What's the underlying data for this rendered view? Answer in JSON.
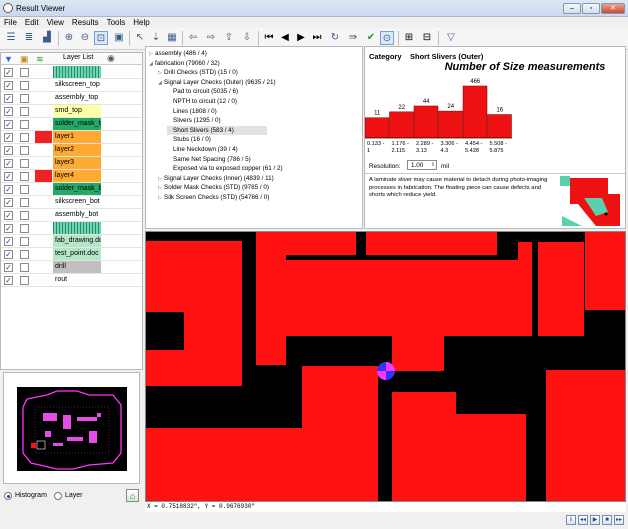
{
  "window": {
    "title": "Result Viewer",
    "buttons": [
      "–",
      "▫",
      "✕"
    ]
  },
  "menu": [
    "File",
    "Edit",
    "View",
    "Results",
    "Tools",
    "Help"
  ],
  "toolbar": {
    "icons": [
      "list-icon",
      "list-detail-icon",
      "chart-icon",
      "zoom-in-icon",
      "zoom-out-icon",
      "zoom-window-icon",
      "fit-icon",
      "pointer-icon",
      "down-arrow-icon",
      "grid-icon",
      "arrow-left-icon",
      "arrow-right-icon",
      "arrow-up-icon",
      "arrow-down-icon",
      "first-icon",
      "prev-icon",
      "next-icon",
      "last-icon",
      "refresh-icon",
      "forward-icon",
      "check-icon",
      "measure-icon",
      "export-icon",
      "report-icon",
      "filter-icon"
    ]
  },
  "layers": {
    "header": {
      "title": "Layer List"
    },
    "rows": [
      {
        "name": "",
        "visible": true,
        "bg": "#6fd6b4",
        "fill_pattern": true
      },
      {
        "name": "silkscreen_top",
        "visible": true,
        "bg": "#ffffff"
      },
      {
        "name": "assembly_top",
        "visible": true,
        "bg": "#ffffff"
      },
      {
        "name": "smd_top",
        "visible": true,
        "bg": "#ffffaa"
      },
      {
        "name": "solder_mask_top",
        "visible": true,
        "bg": "#22aa66"
      },
      {
        "name": "layer1",
        "visible": true,
        "bg": "#ffaa33",
        "marker": "#ee2222"
      },
      {
        "name": "layer2",
        "visible": true,
        "bg": "#ffaa33"
      },
      {
        "name": "layer3",
        "visible": true,
        "bg": "#ffaa33"
      },
      {
        "name": "layer4",
        "visible": true,
        "bg": "#ffaa33",
        "marker": "#ee2222"
      },
      {
        "name": "solder_mask_bot",
        "visible": true,
        "bg": "#22aa66"
      },
      {
        "name": "silkscreen_bot",
        "visible": true,
        "bg": "#ffffff"
      },
      {
        "name": "assembly_bot",
        "visible": true,
        "bg": "#ffffff"
      },
      {
        "name": "",
        "visible": true,
        "bg": "#6fd6b4",
        "fill_pattern": true
      },
      {
        "name": "fab_drawing.doc",
        "visible": true,
        "bg": "#b5e6c8"
      },
      {
        "name": "test_point.doc",
        "visible": true,
        "bg": "#b5e6c8"
      },
      {
        "name": "drill",
        "visible": true,
        "bg": "#c0c0c0"
      },
      {
        "name": "rout",
        "visible": true,
        "bg": "#ffffff"
      }
    ]
  },
  "bottom_left": {
    "histogram": "Histogram",
    "layer": "Layer",
    "histogram_selected": true
  },
  "tree": [
    {
      "text": "assembly (486 / 4)",
      "level": 0,
      "arrow": "▷"
    },
    {
      "text": "fabrication (79060 / 32)",
      "level": 0,
      "arrow": "◢"
    },
    {
      "text": "Drill Checks (STD) (15 / 0)",
      "level": 1,
      "arrow": "▷"
    },
    {
      "text": "Signal Layer Checks (Outer) (9635 / 21)",
      "level": 1,
      "arrow": "◢"
    },
    {
      "text": "Pad to circuit (5035 / 6)",
      "level": 2
    },
    {
      "text": "NPTH to circuit (12 / 0)",
      "level": 2
    },
    {
      "text": "Lines (1808 / 0)",
      "level": 2
    },
    {
      "text": "Slivers (1295 / 0)",
      "level": 2
    },
    {
      "text": "Short Slivers (583 / 4)",
      "level": 2,
      "selected": true
    },
    {
      "text": "Stubs (16 / 0)",
      "level": 2
    },
    {
      "text": "Line Neckdown (39 / 4)",
      "level": 2
    },
    {
      "text": "Same Net Spacing (786 / 5)",
      "level": 2
    },
    {
      "text": "Exposed via to exposed copper (61 / 2)",
      "level": 2
    },
    {
      "text": "Signal Layer Checks (Inner) (4839 / 11)",
      "level": 1,
      "arrow": "▷"
    },
    {
      "text": "Solder Mask Checks (STD) (9785 / 0)",
      "level": 1,
      "arrow": "▷"
    },
    {
      "text": "Silk Screen Checks (STD) (54786 / 0)",
      "level": 1,
      "arrow": "▷"
    }
  ],
  "category": {
    "label": "Category",
    "value": "Short Slivers (Outer)"
  },
  "resolution": {
    "label": "Resolution:",
    "value": "1.00",
    "unit": "mil"
  },
  "description": "A laminate sliver may cause material to detach during photo-imaging processes in fabrication. The floating piece can cause defects and shorts which reduce yield.",
  "chart_data": {
    "type": "bar",
    "title": "Number of Size measurements",
    "categories": [
      "0.133 - 1",
      "1.176 - 2.115",
      "2.289 - 3.13",
      "3.306 - 4.3",
      "4.454 - 5.428",
      "5.508 - 5.875"
    ],
    "category_lines": [
      [
        "0.133 -",
        "1"
      ],
      [
        "1.176 -",
        "2.115"
      ],
      [
        "2.289 -",
        "3.13"
      ],
      [
        "3.306 -",
        "4.3"
      ],
      [
        "4.454 -",
        "5.428"
      ],
      [
        "5.508 -",
        "5.875"
      ]
    ],
    "values": [
      11,
      22,
      44,
      24,
      466,
      16
    ],
    "bar_color": "#ee1111",
    "selected_index": 4
  },
  "status": {
    "coords": "X = 0.7518832\", Y = 0.9676930\""
  },
  "nav_buttons": [
    "i",
    "◂◂",
    "▶",
    "■",
    "▸▸"
  ],
  "colors": {
    "copper": "#ff1111",
    "background": "#000000",
    "marker": "#3333ff"
  }
}
